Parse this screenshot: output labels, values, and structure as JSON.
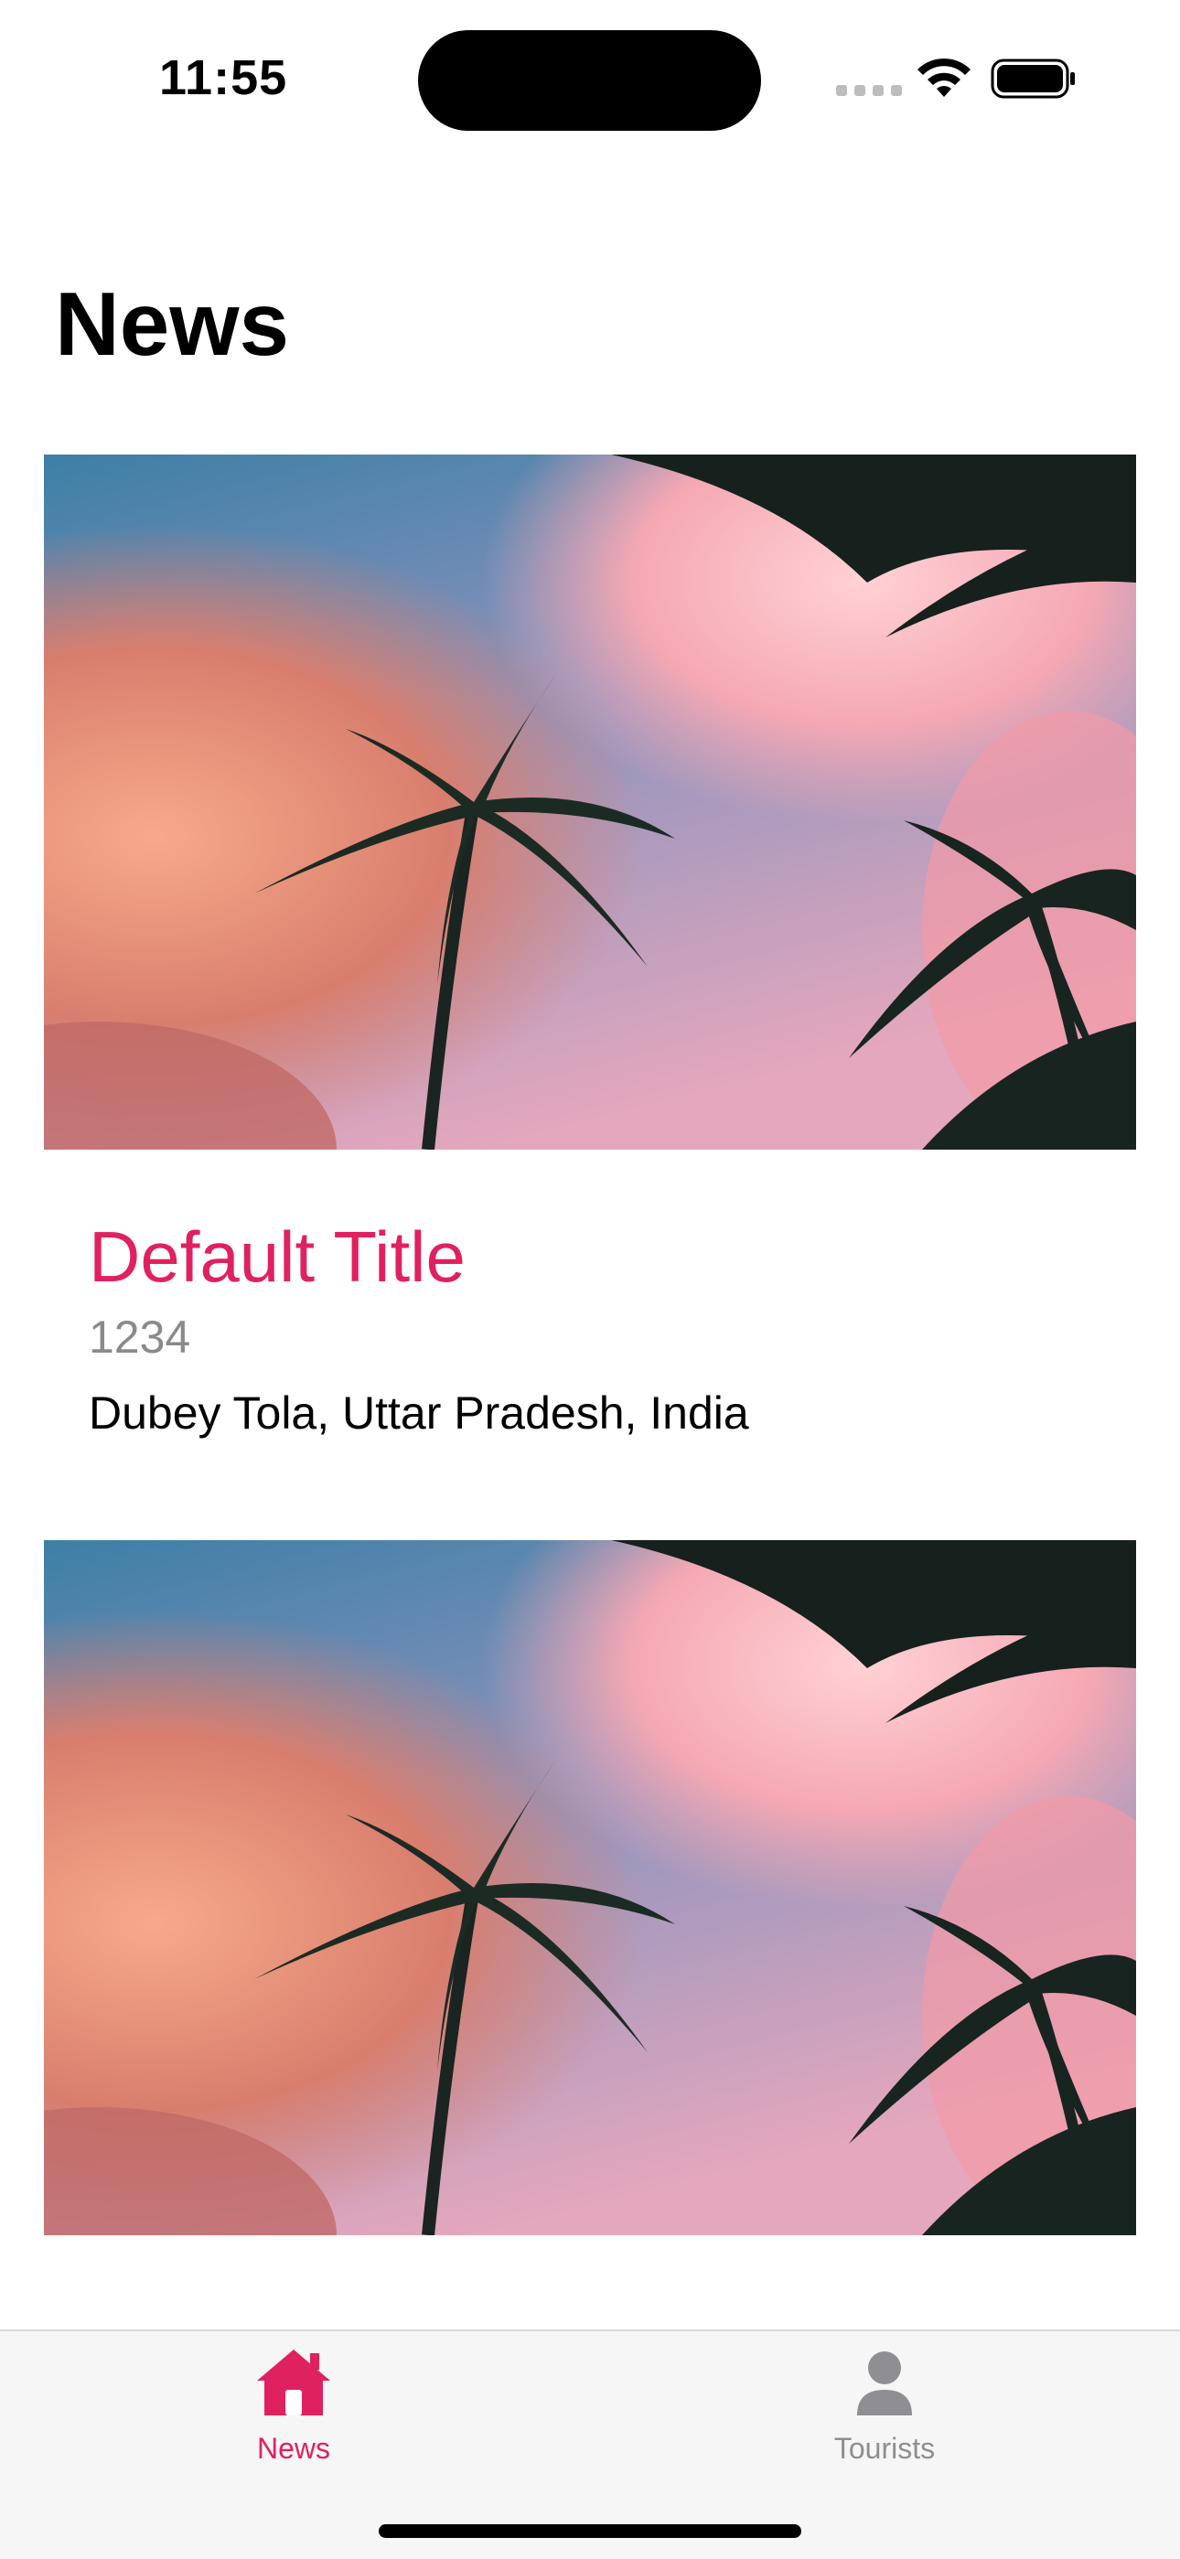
{
  "status_bar": {
    "time": "11:55"
  },
  "header": {
    "title": "News"
  },
  "cards": [
    {
      "image": "palm-trees-sunset-sky",
      "title": "Default Title",
      "number": "1234",
      "location": "Dubey Tola, Uttar Pradesh, India"
    },
    {
      "image": "palm-trees-sunset-sky"
    }
  ],
  "tab_bar": {
    "tabs": [
      {
        "label": "News",
        "icon": "house-icon",
        "selected": true
      },
      {
        "label": "Tourists",
        "icon": "person-icon",
        "selected": false
      }
    ]
  },
  "colors": {
    "accent": "#e0215f",
    "secondary_text": "#8a8a8a",
    "tab_inactive": "#8e8e93",
    "tab_bar_bg": "#f6f6f6"
  }
}
